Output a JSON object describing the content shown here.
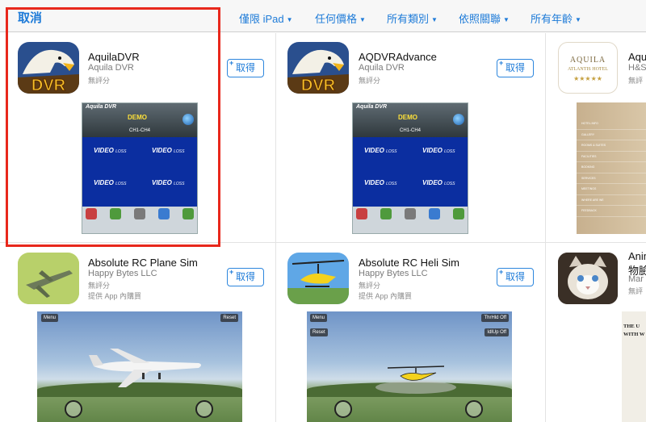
{
  "topbar": {
    "cancel_label": "取消",
    "filters": [
      {
        "label": "僅限 iPad"
      },
      {
        "label": "任何價格"
      },
      {
        "label": "所有類別"
      },
      {
        "label": "依照關聯"
      },
      {
        "label": "所有年齡"
      }
    ]
  },
  "apps": [
    {
      "title": "AquilaDVR",
      "developer": "Aquila DVR",
      "rating": "無評分",
      "get_label": "取得",
      "screenshot": {
        "app_label": "Aquila DVR",
        "demo_label": "DEMO",
        "channel_label": "CH1-CH4",
        "tile_label": "VIDEO",
        "tile_suffix": "LOSS"
      }
    },
    {
      "title": "AQDVRAdvance",
      "developer": "Aquila DVR",
      "rating": "無評分",
      "get_label": "取得",
      "screenshot": {
        "app_label": "Aquila DVR",
        "demo_label": "DEMO",
        "channel_label": "CH1-CH4",
        "tile_label": "VIDEO",
        "tile_suffix": "LOSS"
      }
    },
    {
      "title": "Aqu",
      "developer": "H&S",
      "rating": "無評",
      "icon_text": {
        "name": "AQUILA",
        "sub": "ATLANTIS HOTEL",
        "stars": "★★★★★"
      },
      "screenshot_menu": [
        "HOTEL INFO",
        "GALLERY",
        "ROOMS & SUITES",
        "FACILITIES",
        "BOOKING",
        "SERVICES",
        "MEETINGS",
        "WHERE ARE WE",
        "FEEDBACK"
      ]
    },
    {
      "title": "Absolute RC Plane Sim",
      "developer": "Happy Bytes LLC",
      "rating": "無評分",
      "iap": "提供 App 內購買",
      "get_label": "取得",
      "screenshot": {
        "left_button": "Menu",
        "right_button": "Reset"
      }
    },
    {
      "title": "Absolute RC Heli Sim",
      "developer": "Happy Bytes LLC",
      "rating": "無評分",
      "iap": "提供 App 內購買",
      "get_label": "取得",
      "screenshot": {
        "menu_button": "Menu",
        "reset_button": "Reset",
        "thr_button": "ThrHld Off",
        "idl_button": "IdlUp Off"
      }
    },
    {
      "title": "Anim",
      "title2": "物臉",
      "developer": "Mar",
      "rating": "無評",
      "screenshot_text": "THE U WITH W"
    }
  ],
  "colors": {
    "accent": "#1e7bd8",
    "highlight": "#e8281c",
    "dvr_blue": "#0b2ea0",
    "demo_yellow": "#ffe23a"
  },
  "icons": [
    "eagle-dvr-icon",
    "hotel-logo-icon",
    "plane-icon",
    "helicopter-icon",
    "cat-icon",
    "caret-down-icon",
    "plus-icon"
  ]
}
